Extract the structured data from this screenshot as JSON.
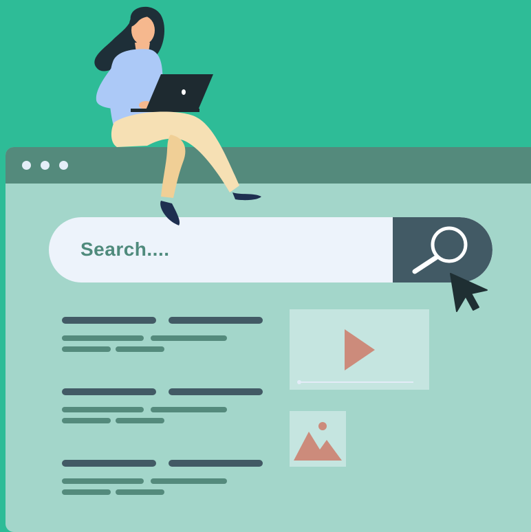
{
  "search": {
    "placeholder": "Search...."
  },
  "window": {
    "control_dots": 3
  },
  "icons": {
    "search_button": "magnifier-icon",
    "cursor": "arrow-cursor-icon",
    "video": "play-icon",
    "image": "mountain-image-icon"
  },
  "colors": {
    "background": "#2ebc97",
    "browser_body": "#a3d6ca",
    "titlebar": "#548a7c",
    "search_field": "#edf3fb",
    "search_button": "#425a65",
    "text_accent": "#4f8a7c",
    "media_accent": "#cc8b7b"
  }
}
